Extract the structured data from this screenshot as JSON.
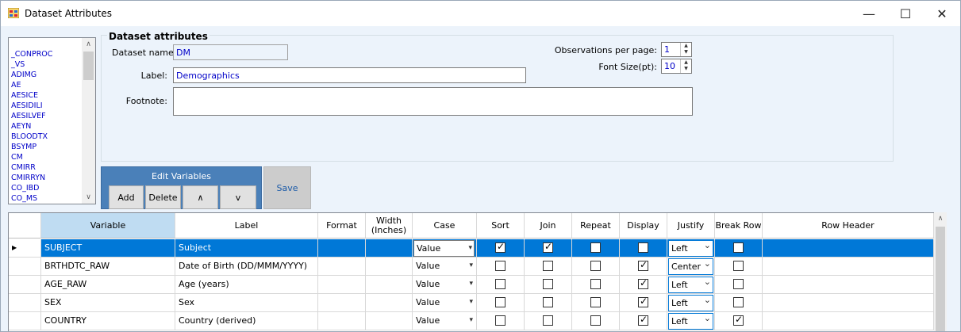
{
  "window": {
    "title": "Dataset Attributes"
  },
  "datasets": [
    "_CONPROC",
    "_VS",
    "ADIMG",
    "AE",
    "AESICE",
    "AESIDILI",
    "AESILVEF",
    "AEYN",
    "BLOODTX",
    "BSYMP",
    "CM",
    "CMIRR",
    "CMIRRYN",
    "CO_IBD",
    "CO_MS"
  ],
  "attributes": {
    "group_title": "Dataset attributes",
    "dataset_name_label": "Dataset name:",
    "dataset_name": "DM",
    "label_label": "Label:",
    "label": "Demographics",
    "footnote_label": "Footnote:",
    "footnote": "",
    "obs_label": "Observations per page:",
    "obs_value": "1",
    "font_label": "Font Size(pt):",
    "font_value": "10"
  },
  "edit_vars": {
    "title": "Edit Variables",
    "add": "Add",
    "delete": "Delete",
    "up": "∧",
    "down": "v"
  },
  "save": "Save",
  "columns": [
    "Variable",
    "Label",
    "Format",
    "Width (Inches)",
    "Case",
    "Sort",
    "Join",
    "Repeat",
    "Display",
    "Justify",
    "Break Row",
    "Row Header"
  ],
  "rows": [
    {
      "variable": "SUBJECT",
      "label": "Subject",
      "case": "Value",
      "sort": true,
      "join": true,
      "repeat": false,
      "display": false,
      "justify": "Left",
      "break": false,
      "selected": true
    },
    {
      "variable": "BRTHDTC_RAW",
      "label": "Date of Birth (DD/MMM/YYYY)",
      "case": "Value",
      "sort": false,
      "join": false,
      "repeat": false,
      "display": true,
      "justify": "Center",
      "break": false,
      "selected": false
    },
    {
      "variable": "AGE_RAW",
      "label": "Age (years)",
      "case": "Value",
      "sort": false,
      "join": false,
      "repeat": false,
      "display": true,
      "justify": "Left",
      "break": false,
      "selected": false
    },
    {
      "variable": "SEX",
      "label": "Sex",
      "case": "Value",
      "sort": false,
      "join": false,
      "repeat": false,
      "display": true,
      "justify": "Left",
      "break": false,
      "selected": false
    },
    {
      "variable": "COUNTRY",
      "label": "Country (derived)",
      "case": "Value",
      "sort": false,
      "join": false,
      "repeat": false,
      "display": true,
      "justify": "Left",
      "break": true,
      "selected": false
    }
  ]
}
